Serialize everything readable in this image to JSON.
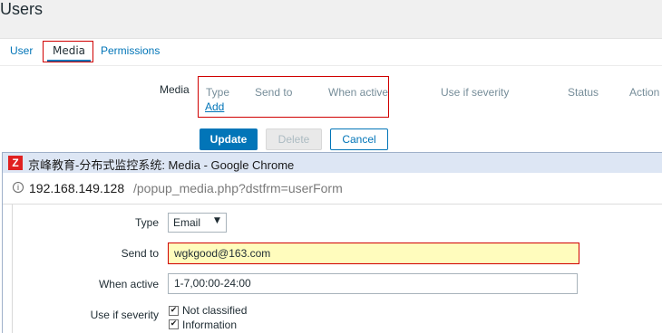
{
  "page": {
    "title": "Users"
  },
  "tabs": [
    {
      "label": "User"
    },
    {
      "label": "Media"
    },
    {
      "label": "Permissions"
    }
  ],
  "media": {
    "label": "Media",
    "columns": [
      "Type",
      "Send to",
      "When active",
      "Use if severity",
      "Status",
      "Action"
    ],
    "add_label": "Add"
  },
  "buttons": {
    "update": "Update",
    "delete": "Delete",
    "cancel": "Cancel"
  },
  "popup": {
    "window_title": "京峰教育-分布式监控系统: Media - Google Chrome",
    "app_icon": "Z",
    "url_host": "192.168.149.128",
    "url_path": "/popup_media.php?dstfrm=userForm",
    "form": {
      "type_label": "Type",
      "type_value": "Email",
      "sendto_label": "Send to",
      "sendto_value": "wgkgood@163.com",
      "when_label": "When active",
      "when_value": "1-7,00:00-24:00",
      "severity_label": "Use if severity",
      "severities": [
        {
          "label": "Not classified",
          "checked": true
        },
        {
          "label": "Information",
          "checked": true
        }
      ]
    }
  },
  "colors": {
    "accent": "#0275b8",
    "highlight_border": "#d00000",
    "input_highlight": "#fffcbd"
  }
}
